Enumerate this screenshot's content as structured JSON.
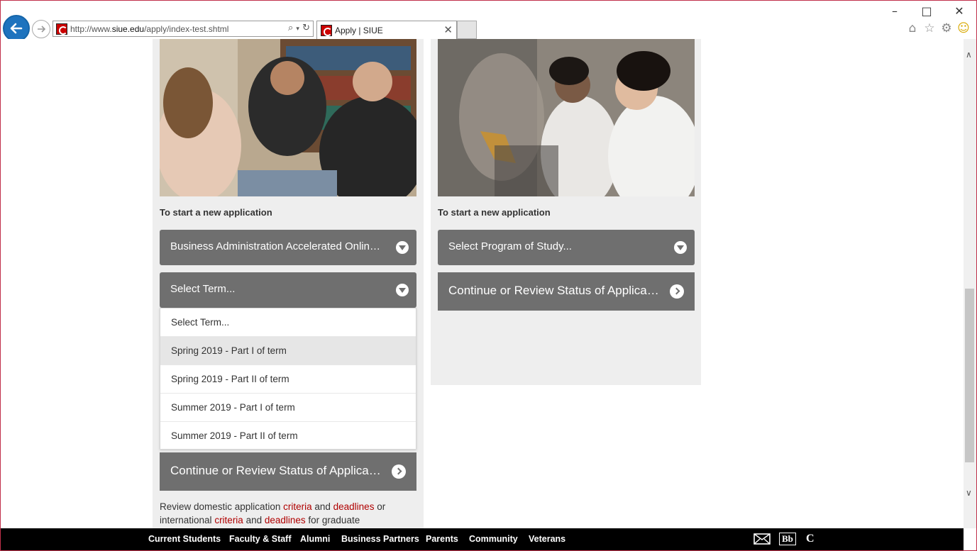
{
  "browser": {
    "address": "http://www.siue.edu/apply/index-test.shtml",
    "address_prefix": "http://www.",
    "address_domain": "siue.edu",
    "address_path": "/apply/index-test.shtml",
    "tab_title": "Apply | SIUE",
    "icons": {
      "back": "back-arrow-icon",
      "forward": "forward-arrow-icon",
      "search": "search-icon",
      "refresh": "refresh-icon",
      "home": "home-icon",
      "favorites": "star-icon",
      "settings": "gear-icon",
      "feedback": "smiley-icon"
    }
  },
  "left_card": {
    "heading": "To start a new application",
    "program_select": "Business Administration Accelerated Online MBA",
    "term_select": "Select Term...",
    "term_options": [
      {
        "label": "Select Term..."
      },
      {
        "label": "Spring 2019 - Part I of term",
        "highlighted": true
      },
      {
        "label": "Spring 2019 - Part II of term"
      },
      {
        "label": "Summer 2019 - Part I of term"
      },
      {
        "label": "Summer 2019 - Part II of term"
      }
    ],
    "continue_label": "Continue or Review Status of Application",
    "review": {
      "t1": "Review domestic application ",
      "link1": "criteria",
      "t2": " and ",
      "link2": "deadlines",
      "t3": " or international ",
      "link3": "criteria",
      "t4": " and ",
      "link4": "deadlines",
      "t5": " for graduate"
    }
  },
  "right_card": {
    "heading": "To start a new application",
    "program_select": "Select Program of Study...",
    "continue_label": "Continue or Review Status of Application"
  },
  "footer": {
    "links": [
      "Current Students",
      "Faculty & Staff",
      "Alumni",
      "Business Partners",
      "Parents",
      "Community",
      "Veterans"
    ],
    "icons": [
      "mail-icon",
      "blackboard-icon",
      "cougarnet-icon"
    ],
    "blackboard_text": "Bb",
    "cougarnet_text": "C"
  },
  "colors": {
    "accent_red": "#b00000",
    "bar_gray": "#6f6f6f",
    "card_bg": "#eeeeee",
    "footer_bg": "#000000",
    "back_button": "#1e73be"
  }
}
